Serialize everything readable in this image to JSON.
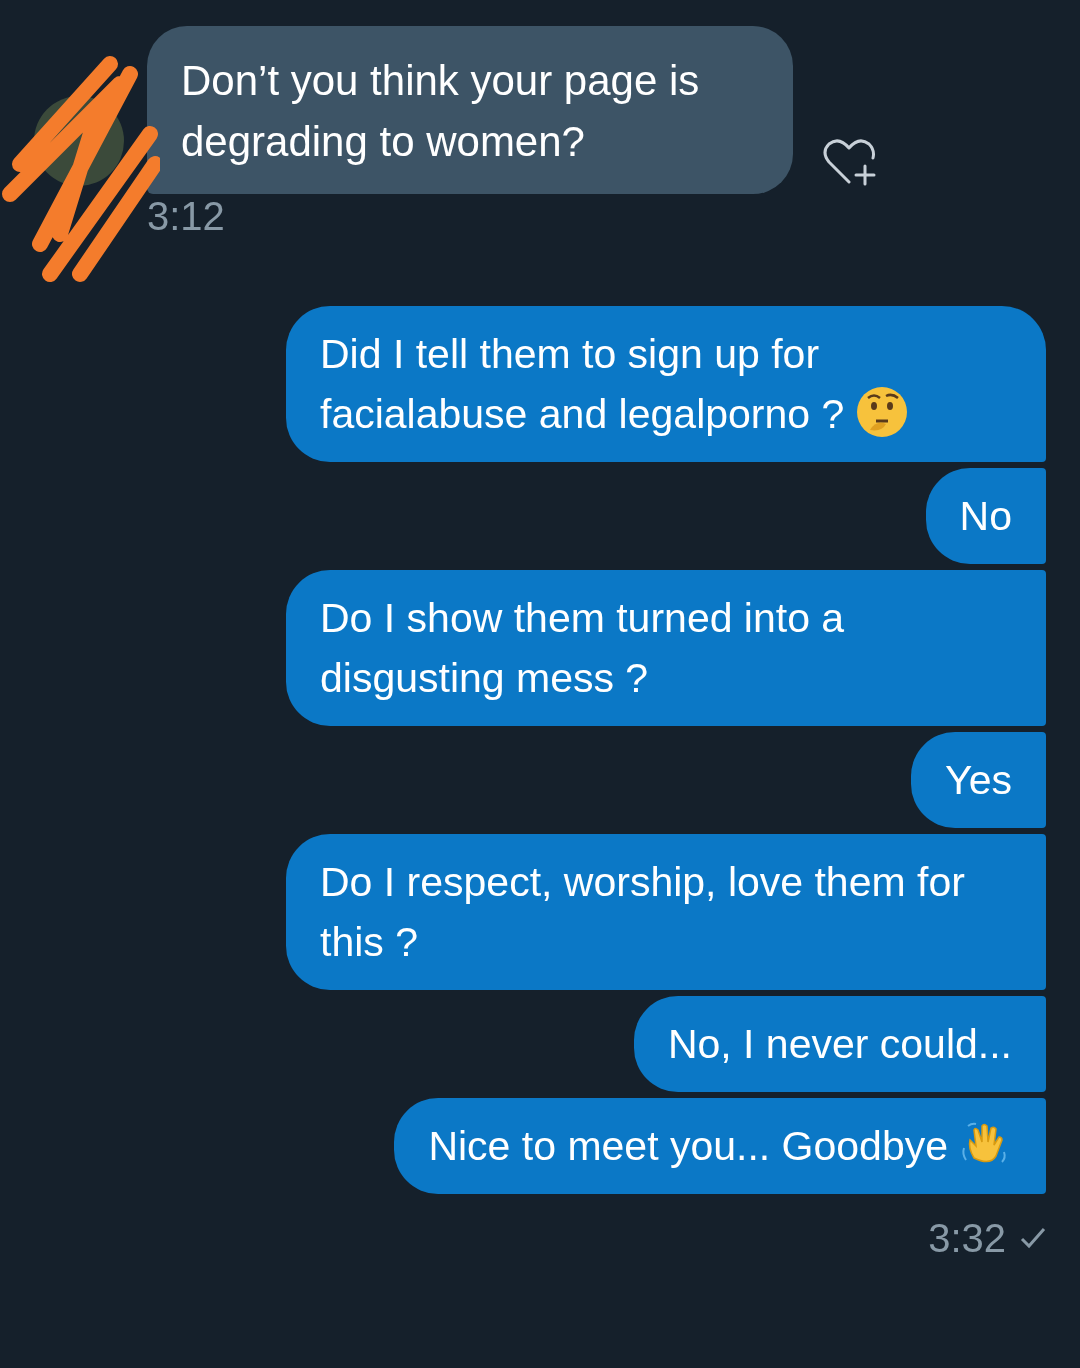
{
  "messages": [
    {
      "kind": "received",
      "text": "Don’t you think your page is degrading to women?",
      "time": "3:12"
    },
    {
      "kind": "sent",
      "text": "Did I tell them to sign up for facialabuse and legalporno ?",
      "emoji": {
        "kind": "thinking"
      }
    },
    {
      "kind": "sent",
      "text": "No"
    },
    {
      "kind": "sent",
      "text": "Do I show them turned into a disgusting mess ?"
    },
    {
      "kind": "sent",
      "text": "Yes"
    },
    {
      "kind": "sent",
      "text": "Do I respect, worship, love them for this ?"
    },
    {
      "kind": "sent",
      "text": "No, I never could..."
    },
    {
      "kind": "sent",
      "text": "Nice to meet you... Goodbye",
      "emoji": {
        "kind": "wave"
      }
    }
  ],
  "sent_status": {
    "time": "3:32",
    "read": true
  }
}
